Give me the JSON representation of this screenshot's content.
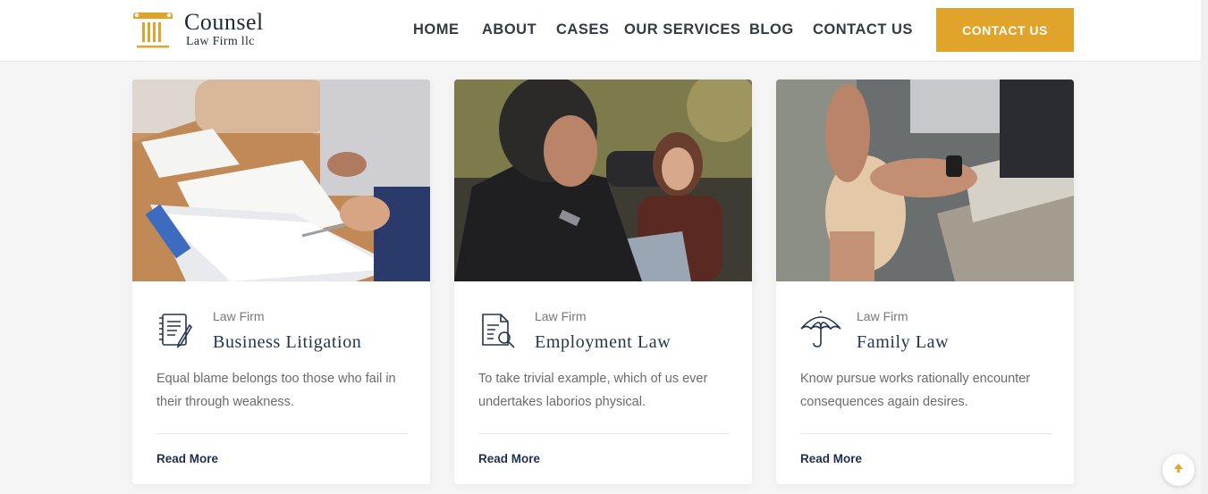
{
  "brand": {
    "title": "Counsel",
    "subtitle": "Law Firm llc",
    "accent": "#e0a42a",
    "navy": "#22364f"
  },
  "nav": {
    "items": [
      "HOME",
      "ABOUT",
      "CASES",
      "OUR SERVICES",
      "BLOG",
      "CONTACT US"
    ]
  },
  "header": {
    "cta_label": "CONTACT US"
  },
  "cards": [
    {
      "category": "Law Firm",
      "title": "Business Litigation",
      "description": "Equal blame belongs too those who fail in their through weakness.",
      "link": "Read More",
      "icon": "document-pen-icon"
    },
    {
      "category": "Law Firm",
      "title": "Employment Law",
      "description": "To take trivial example, which of us ever undertakes laborios physical.",
      "link": "Read More",
      "icon": "document-search-icon"
    },
    {
      "category": "Law Firm",
      "title": "Family Law",
      "description": "Know pursue works rationally encounter consequences again desires.",
      "link": "Read More",
      "icon": "umbrella-icon"
    }
  ],
  "scroll_top_icon": "arrow-up-icon"
}
